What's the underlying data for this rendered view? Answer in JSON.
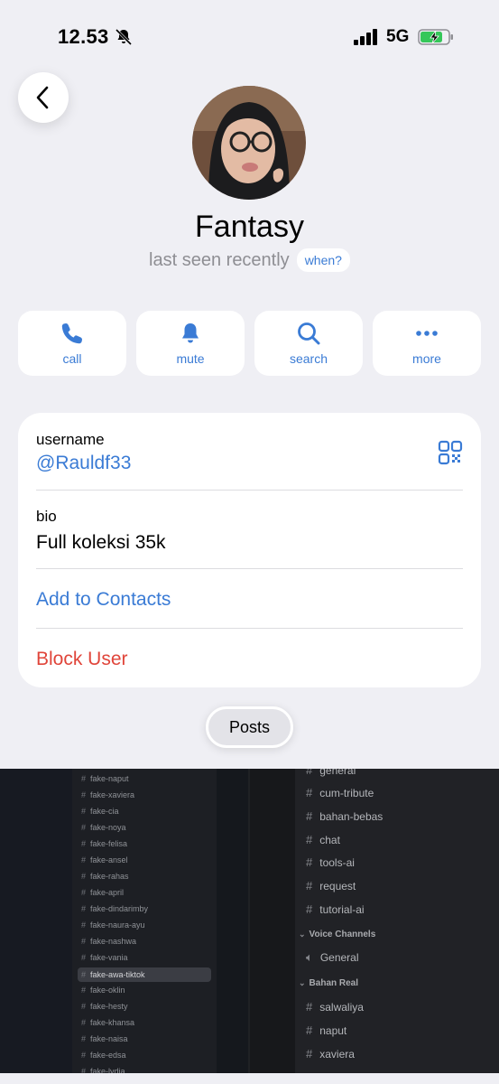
{
  "status": {
    "time": "12.53",
    "network": "5G",
    "icons": [
      "bell-slash-icon",
      "signal-icon",
      "battery-charging-icon"
    ]
  },
  "profile": {
    "name": "Fantasy",
    "last_seen": "last seen recently",
    "when_label": "when?"
  },
  "actions": [
    {
      "label": "call",
      "icon": "phone-icon"
    },
    {
      "label": "mute",
      "icon": "bell-icon"
    },
    {
      "label": "search",
      "icon": "search-icon"
    },
    {
      "label": "more",
      "icon": "more-icon"
    }
  ],
  "info": {
    "username_label": "username",
    "username_value": "@Rauldf33",
    "bio_label": "bio",
    "bio_value": "Full koleksi 35k",
    "add_contacts": "Add to Contacts",
    "block_user": "Block User"
  },
  "posts_tab": "Posts",
  "posts_grid": {
    "left_channels": [
      "fake-naput",
      "fake-xaviera",
      "fake-cia",
      "fake-noya",
      "fake-felisa",
      "fake-ansel",
      "fake-rahas",
      "fake-april",
      "fake-dindarimby",
      "fake-naura-ayu",
      "fake-nashwa",
      "fake-vania",
      "fake-awa-tiktok",
      "fake-oklin",
      "fake-hesty",
      "fake-khansa",
      "fake-naisa",
      "fake-edsa",
      "fake-lydia"
    ],
    "left_active": "fake-awa-tiktok",
    "right_channels_top": [
      "general",
      "cum-tribute",
      "bahan-bebas",
      "chat",
      "tools-ai",
      "request",
      "tutorial-ai"
    ],
    "voice_category": "Voice Channels",
    "voice_channel": "General",
    "real_category": "Bahan Real",
    "right_channels_bottom": [
      "salwaliya",
      "naput",
      "xaviera"
    ]
  },
  "colors": {
    "accent": "#3a7bd5",
    "danger": "#e0453a",
    "background": "#efeff4"
  }
}
